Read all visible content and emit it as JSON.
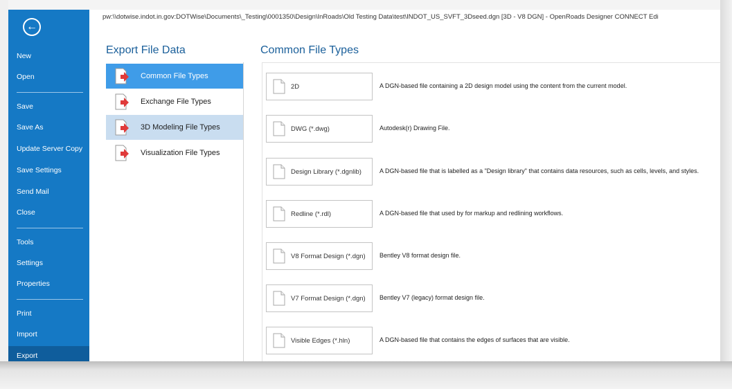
{
  "title_path": "pw:\\\\dotwise.indot.in.gov:DOTWise\\Documents\\_Testing\\0001350\\Design\\InRoads\\Old Testing Data\\test\\INDOT_US_SVFT_3Dseed.dgn [3D - V8 DGN] - OpenRoads Designer CONNECT Edi",
  "nav": {
    "back_icon": "back-arrow-circle-icon",
    "items": [
      {
        "label": "New"
      },
      {
        "label": "Open"
      },
      {
        "label": "Save"
      },
      {
        "label": "Save As"
      },
      {
        "label": "Update Server Copy"
      },
      {
        "label": "Save Settings"
      },
      {
        "label": "Send Mail"
      },
      {
        "label": "Close"
      },
      {
        "label": "Tools"
      },
      {
        "label": "Settings"
      },
      {
        "label": "Properties"
      },
      {
        "label": "Print"
      },
      {
        "label": "Import"
      },
      {
        "label": "Export"
      }
    ],
    "active": "Export"
  },
  "export_file_data": {
    "heading": "Export File Data",
    "categories": [
      {
        "label": "Common File Types",
        "state": "selected"
      },
      {
        "label": "Exchange File Types",
        "state": "normal"
      },
      {
        "label": "3D Modeling File Types",
        "state": "hover"
      },
      {
        "label": "Visualization File Types",
        "state": "normal"
      }
    ]
  },
  "common_file_types": {
    "heading": "Common File Types",
    "items": [
      {
        "label": "2D",
        "description": "A DGN-based file containing a 2D design model using the content from the current model."
      },
      {
        "label": "DWG (*.dwg)",
        "description": "Autodesk(r) Drawing File."
      },
      {
        "label": "Design Library (*.dgnlib)",
        "description": "A DGN-based file that is labelled as a \"Design library\" that contains data resources, such as cells, levels, and styles."
      },
      {
        "label": "Redline (*.rdl)",
        "description": "A DGN-based file that used by for markup and redlining workflows."
      },
      {
        "label": "V8 Format Design (*.dgn)",
        "description": "Bentley V8 format design file."
      },
      {
        "label": "V7 Format Design (*.dgn)",
        "description": "Bentley V7 (legacy) format design file."
      },
      {
        "label": "Visible Edges (*.hln)",
        "description": "A DGN-based file that contains the edges of surfaces that are visible."
      }
    ]
  },
  "colors": {
    "nav_background": "#1579c5",
    "nav_active": "#0f5d9c",
    "selected_category": "#3f9ce8",
    "hover_category": "#c9ddf0",
    "heading": "#1a5f9a",
    "export_arrow": "#e03a3a"
  }
}
